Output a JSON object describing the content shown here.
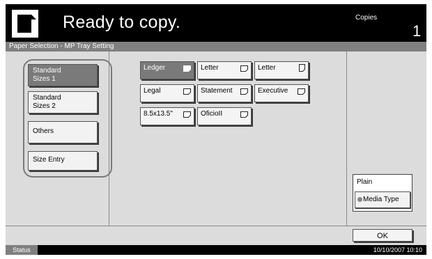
{
  "header": {
    "title": "Ready to copy.",
    "copies_label": "Copies",
    "copies_value": "1"
  },
  "panel": {
    "title": "Paper Selection - MP Tray Setting"
  },
  "tabs": [
    {
      "line1": "Standard",
      "line2": "Sizes 1",
      "active": true
    },
    {
      "line1": "Standard",
      "line2": "Sizes 2",
      "active": false
    },
    {
      "line1": "Others",
      "line2": "",
      "active": false
    },
    {
      "line1": "Size Entry",
      "line2": "",
      "active": false
    }
  ],
  "sizes": [
    {
      "label": "Ledger",
      "orientation": "landscape",
      "selected": true
    },
    {
      "label": "Letter",
      "orientation": "landscape",
      "selected": false
    },
    {
      "label": "Letter",
      "orientation": "portrait",
      "selected": false
    },
    {
      "label": "Legal",
      "orientation": "landscape",
      "selected": false
    },
    {
      "label": "Statement",
      "orientation": "landscape",
      "selected": false
    },
    {
      "label": "Executive",
      "orientation": "landscape",
      "selected": false
    },
    {
      "label": "8.5x13.5\"",
      "orientation": "landscape",
      "selected": false
    },
    {
      "label": "OficioII",
      "orientation": "landscape",
      "selected": false
    }
  ],
  "media": {
    "current": "Plain",
    "button_label": "Media Type"
  },
  "ok_label": "OK",
  "status": {
    "label": "Status",
    "datetime": "10/10/2007  10:10"
  }
}
